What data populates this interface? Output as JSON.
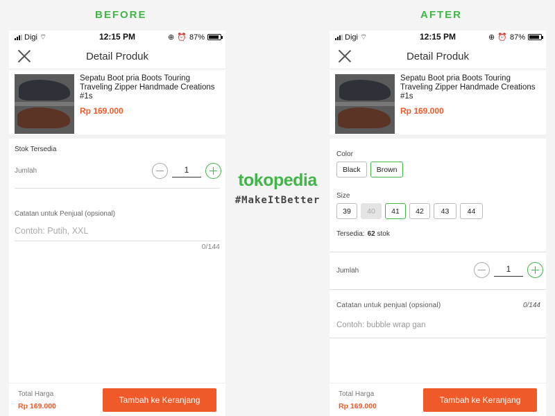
{
  "labels": {
    "before": "BEFORE",
    "after": "AFTER"
  },
  "colors": {
    "accent_green": "#42b549",
    "accent_orange": "#f05a28"
  },
  "status_bar": {
    "carrier": "Digi",
    "time": "12:15 PM",
    "battery": "87%",
    "battery_level": 0.87
  },
  "header": {
    "title": "Detail Produk"
  },
  "product": {
    "name": "Sepatu Boot pria Boots Touring Traveling Zipper Handmade Creations #1s",
    "price": "Rp 169.000"
  },
  "before": {
    "stock_label": "Stok Tersedia",
    "quantity_label": "Jumlah",
    "quantity": "1",
    "note_label": "Catatan untuk Penjual (opsional)",
    "note_placeholder": "Contoh: Putih, XXL",
    "note_count": "0/144"
  },
  "after": {
    "color_label": "Color",
    "colors": [
      "Black",
      "Brown"
    ],
    "selected_color": "Brown",
    "size_label": "Size",
    "sizes": [
      "39",
      "40",
      "41",
      "42",
      "43",
      "44"
    ],
    "selected_size": "41",
    "disabled_size": "40",
    "stock_label": "Tersedia:",
    "stock_count": "62",
    "stock_unit": "stok",
    "quantity_label": "Jumlah",
    "quantity": "1",
    "note_label": "Catatan untuk penjual (opsional)",
    "note_count": "0/144",
    "note_placeholder": "Contoh: bubble wrap gan"
  },
  "footer": {
    "total_label": "Total Harga",
    "total_value": "Rp 169.000",
    "cart_button": "Tambah ke Keranjang"
  },
  "brand": {
    "name": "tokopedia",
    "hashtag": "#MakeItBetter"
  }
}
